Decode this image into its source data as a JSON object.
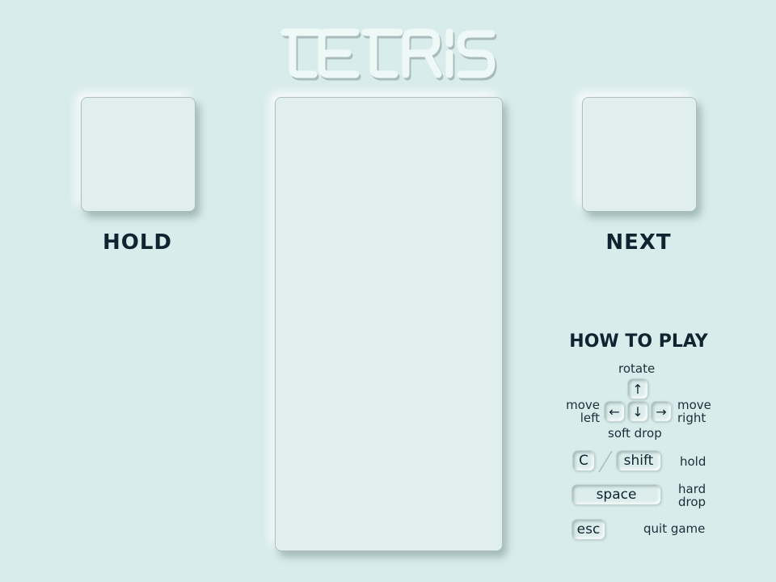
{
  "title": "TETRIS",
  "hold": {
    "label": "HOLD"
  },
  "next": {
    "label": "NEXT"
  },
  "how_to_play": {
    "title": "HOW TO PLAY",
    "rotate_label": "rotate",
    "move_left_line1": "move",
    "move_left_line2": "left",
    "move_right_line1": "move",
    "move_right_line2": "right",
    "soft_drop_label": "soft drop",
    "keys": {
      "up": "↑",
      "left": "←",
      "down": "↓",
      "right": "→",
      "c": "C",
      "shift": "shift",
      "space": "space",
      "esc": "esc"
    },
    "hold_label": "hold",
    "hard_drop_line1": "hard",
    "hard_drop_line2": "drop",
    "quit_label": "quit game"
  },
  "colors": {
    "background": "#d8eceb",
    "panel": "#e0efee",
    "text": "#0f2431"
  }
}
